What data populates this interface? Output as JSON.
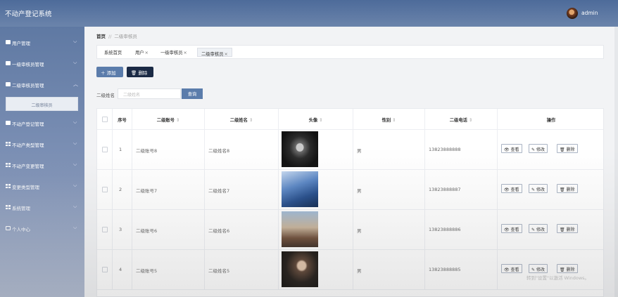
{
  "header": {
    "title": "不动产登记系统",
    "username": "admin"
  },
  "sidebar": {
    "items": [
      {
        "label": "用户管理",
        "icon": "bag-icon"
      },
      {
        "label": "一级审核员管理",
        "icon": "bag-icon"
      },
      {
        "label": "二级审核员管理",
        "icon": "bag-icon",
        "expanded": true
      },
      {
        "label": "不动产登记管理",
        "icon": "bag-icon"
      },
      {
        "label": "不动产类型管理",
        "icon": "grid-icon"
      },
      {
        "label": "不动产变更管理",
        "icon": "grid-icon"
      },
      {
        "label": "变更类型管理",
        "icon": "grid-icon"
      },
      {
        "label": "系统管理",
        "icon": "grid-icon"
      },
      {
        "label": "个人中心",
        "icon": "window-icon"
      }
    ],
    "sub_item": "二级审核员"
  },
  "breadcrumb": {
    "home": "首页",
    "sep": "//",
    "current": "二级审核员"
  },
  "tabs": [
    {
      "label": "系统首页",
      "closable": false
    },
    {
      "label": "用户",
      "closable": true
    },
    {
      "label": "一级审核员",
      "closable": true
    },
    {
      "label": "二级审核员",
      "closable": true,
      "active": true
    }
  ],
  "toolbar": {
    "add_label": "添加",
    "delete_label": "删除"
  },
  "search": {
    "label": "二级姓名",
    "placeholder": "二级姓名",
    "button": "查询"
  },
  "table": {
    "columns": [
      "序号",
      "二级账号",
      "二级姓名",
      "头像",
      "性别",
      "二级电话",
      "操作"
    ],
    "rows": [
      {
        "index": "1",
        "account": "二级账号8",
        "name": "二级姓名8",
        "gender": "男",
        "phone": "13823888888"
      },
      {
        "index": "2",
        "account": "二级账号7",
        "name": "二级姓名7",
        "gender": "男",
        "phone": "13823888887"
      },
      {
        "index": "3",
        "account": "二级账号6",
        "name": "二级姓名6",
        "gender": "男",
        "phone": "13823888886"
      },
      {
        "index": "4",
        "account": "二级账号5",
        "name": "二级姓名5",
        "gender": "男",
        "phone": "13823888885"
      }
    ],
    "actions": {
      "view": "查看",
      "edit": "修改",
      "delete": "删除"
    }
  },
  "watermark": "转到\"设置\"以激活 Windows。",
  "colors": {
    "header": "#4d6b9a",
    "sidebar": "#6c83aa",
    "primary": "#5b7cab",
    "danger": "#1b2a45"
  }
}
